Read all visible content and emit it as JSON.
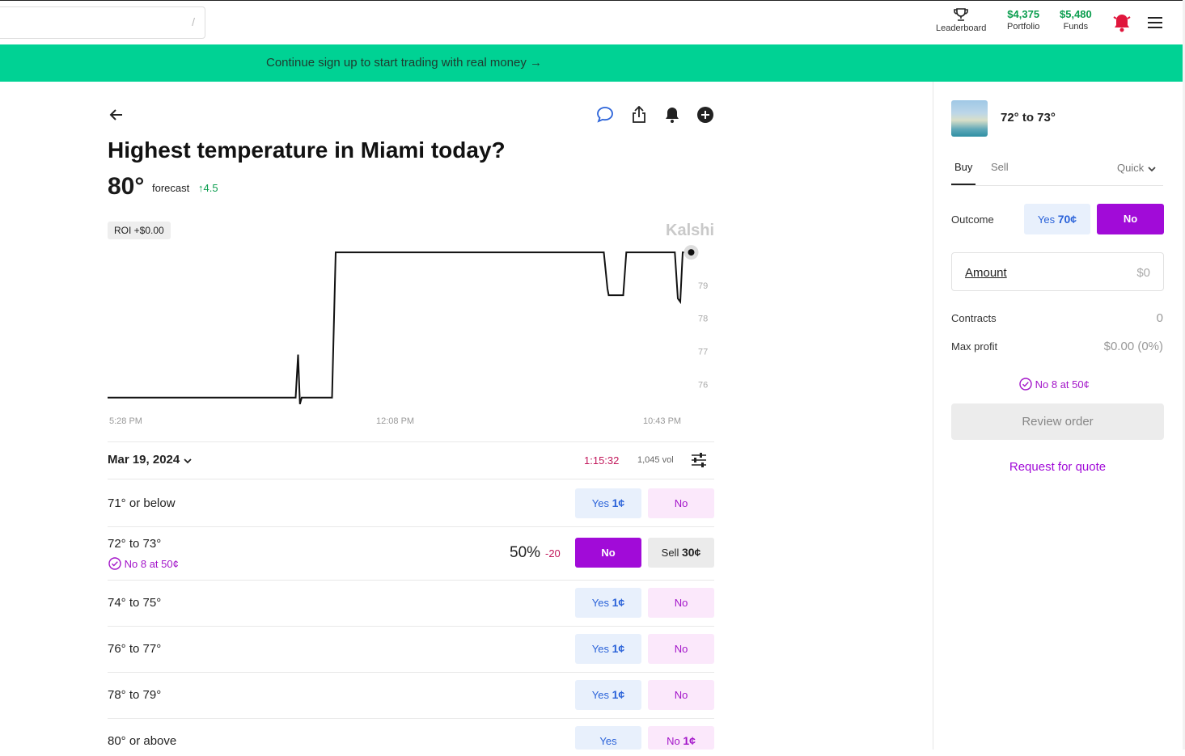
{
  "header": {
    "search_shortcut": "/",
    "leaderboard_label": "Leaderboard",
    "portfolio_value": "$4,375",
    "portfolio_label": "Portfolio",
    "funds_value": "$5,480",
    "funds_label": "Funds"
  },
  "banner": {
    "text": "Continue sign up to start trading with real money →"
  },
  "market": {
    "title": "Highest temperature in Miami today?",
    "forecast_value": "80°",
    "forecast_label": "forecast",
    "forecast_change": "↑4.5",
    "roi": "ROI +$0.00",
    "watermark": "Kalshi"
  },
  "chart_data": {
    "type": "line",
    "x_tick_labels": [
      "5:28 PM",
      "12:08 PM",
      "10:43 PM"
    ],
    "y_tick_labels": [
      "79",
      "78",
      "77",
      "76"
    ],
    "ylim": [
      75.2,
      80.1
    ],
    "x": [
      0,
      0.3,
      0.31,
      0.314,
      0.317,
      0.32,
      0.37,
      0.376,
      0.38,
      0.818,
      0.824,
      0.826,
      0.85,
      0.855,
      0.86,
      0.935,
      0.94,
      0.944,
      0.948,
      0.955,
      0.962
    ],
    "series": [
      {
        "values": [
          75.6,
          75.6,
          75.6,
          76.9,
          75.4,
          75.6,
          75.6,
          80.0,
          80.0,
          80.0,
          78.9,
          78.7,
          78.7,
          80.0,
          80.0,
          80.0,
          78.6,
          78.5,
          80.0,
          80.0,
          80.0
        ]
      }
    ]
  },
  "list": {
    "date": "Mar 19, 2024",
    "timer": "1:15:32",
    "volume": "1,045 vol",
    "rows": [
      {
        "label": "71° or below",
        "yes_label": "Yes",
        "yes_price": "1¢",
        "no_label": "No"
      },
      {
        "label": "72° to 73°",
        "note": "No 8 at 50¢",
        "chance": "50%",
        "chance_change": "-20",
        "no_label": "No",
        "sell_label": "Sell",
        "sell_price": "30¢"
      },
      {
        "label": "74° to 75°",
        "yes_label": "Yes",
        "yes_price": "1¢",
        "no_label": "No"
      },
      {
        "label": "76° to 77°",
        "yes_label": "Yes",
        "yes_price": "1¢",
        "no_label": "No"
      },
      {
        "label": "78° to 79°",
        "yes_label": "Yes",
        "yes_price": "1¢",
        "no_label": "No"
      },
      {
        "label": "80° or above",
        "yes_label": "Yes",
        "no_label": "No",
        "no_price": "1¢"
      }
    ]
  },
  "panel": {
    "title": "72° to 73°",
    "tab_buy": "Buy",
    "tab_sell": "Sell",
    "mode": "Quick",
    "outcome_label": "Outcome",
    "yes_label": "Yes",
    "yes_price": "70¢",
    "no_label": "No",
    "amount_label": "Amount",
    "amount_value": "$0",
    "contracts_label": "Contracts",
    "contracts_value": "0",
    "max_profit_label": "Max profit",
    "max_profit_value": "$0.00 (0%)",
    "position_note": "No 8 at 50¢",
    "review_label": "Review order",
    "rfq_label": "Request for quote"
  },
  "colors": {
    "banner": "#00d294",
    "no": "#a10bd8",
    "yes": "#2b63d9",
    "gain": "#0a9d4e",
    "loss": "#c2185b"
  }
}
